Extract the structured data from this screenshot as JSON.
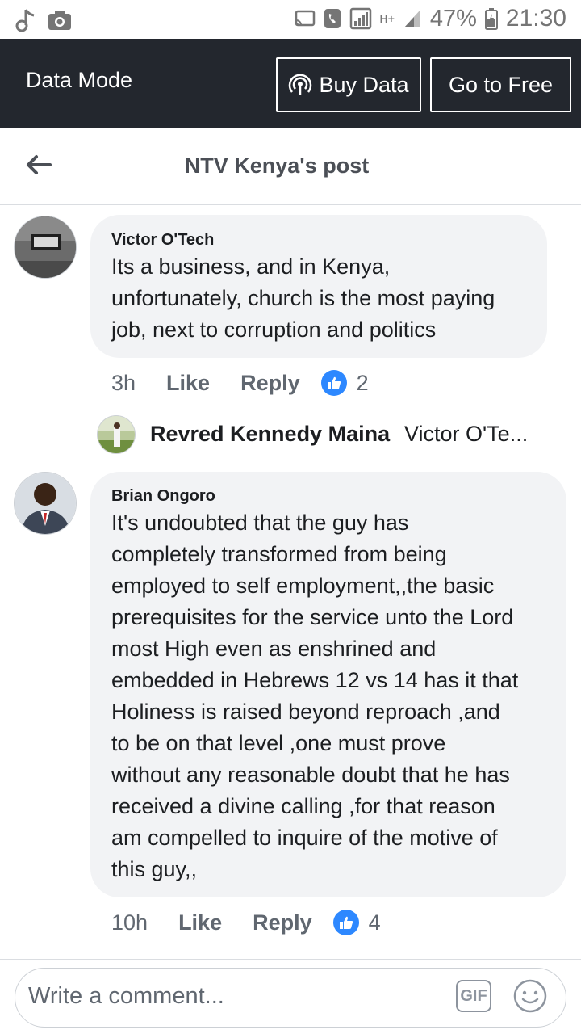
{
  "status_bar": {
    "battery": "47%",
    "time": "21:30",
    "network": "H+"
  },
  "data_bar": {
    "title": "Data Mode",
    "buy_label": "Buy Data",
    "free_label": "Go to Free"
  },
  "header": {
    "title": "NTV Kenya's post"
  },
  "comments": [
    {
      "author": "Victor O'Tech",
      "lines": [
        "Its a business, and in Kenya,",
        "unfortunately, church is the most paying",
        "job, next to corruption and politics"
      ],
      "time": "3h",
      "like_label": "Like",
      "reply_label": "Reply",
      "reactions": "2"
    },
    {
      "author": "Brian Ongoro",
      "lines": [
        "It's undoubted that the guy has",
        "completely transformed from being",
        "employed to self employment,,the basic",
        "prerequisites for the service unto the Lord",
        "most High even as enshrined and",
        "embedded in Hebrews 12 vs 14 has it that",
        "Holiness is raised beyond reproach ,and",
        "to be on that level ,one must prove",
        "without any reasonable doubt that he has",
        "received a divine calling ,for that reason",
        "am compelled to inquire of the motive of",
        "this guy,,"
      ],
      "time": "10h",
      "like_label": "Like",
      "reply_label": "Reply",
      "reactions": "4"
    }
  ],
  "reply_preview": {
    "name": "Revred Kennedy Maina",
    "text": "Victor O'Te..."
  },
  "composer": {
    "placeholder": "Write a comment...",
    "gif_label": "GIF"
  },
  "colors": {
    "data_bar_bg": "#23272e",
    "like_blue": "#2d88ff",
    "bubble_bg": "#f2f3f5"
  }
}
